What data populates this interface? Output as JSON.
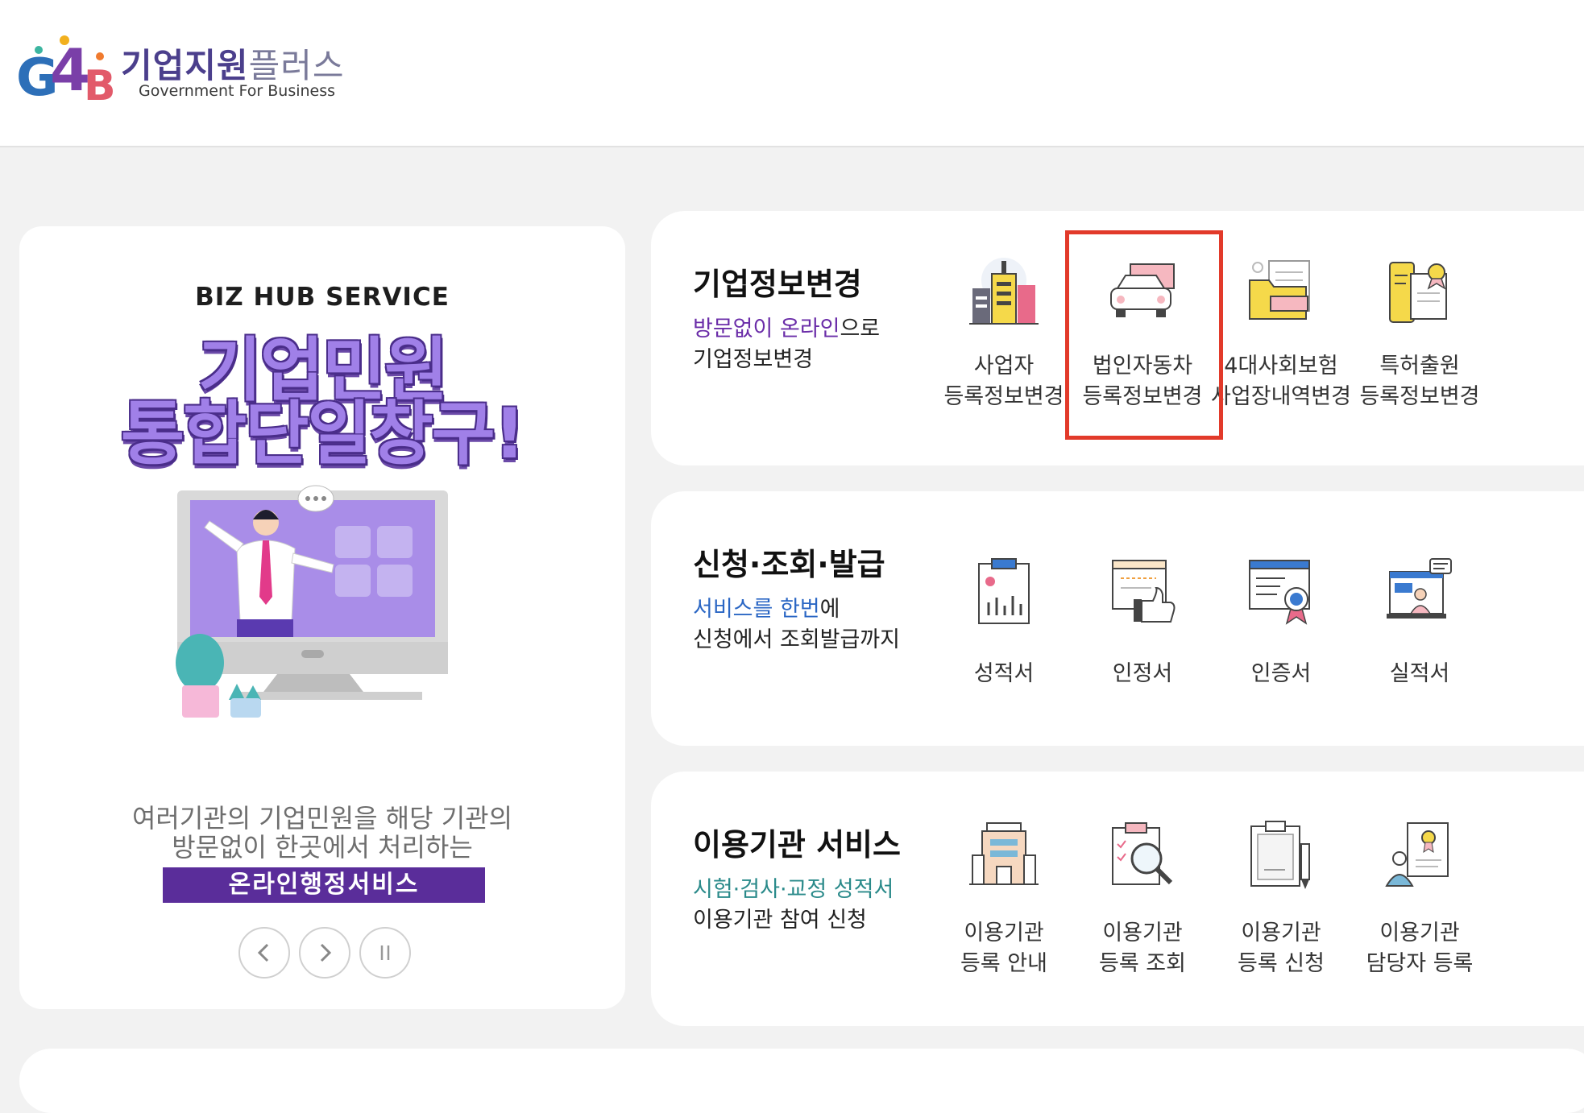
{
  "header": {
    "logo_mark_text": "G4B",
    "logo_title_bold": "기업지원",
    "logo_title_light": "플러스",
    "logo_subtitle": "Government For Business"
  },
  "banner": {
    "kicker": "BIZ HUB SERVICE",
    "title_line1": "기업민원",
    "title_line2": "통합단일창구!",
    "desc_line1": "여러기관의 기업민원을 해당 기관의",
    "desc_line2": "방문없이 한곳에서 처리하는",
    "badge": "온라인행정서비스",
    "controls": {
      "prev": "chevron-left",
      "next": "chevron-right",
      "pause": "pause"
    }
  },
  "sections": [
    {
      "title": "기업정보변경",
      "desc_highlight": "방문없이 온라인",
      "desc_rest": "으로",
      "desc_line2": "기업정보변경",
      "items": [
        {
          "line1": "사업자",
          "line2": "등록정보변경",
          "icon": "building-icon"
        },
        {
          "line1": "법인자동차",
          "line2": "등록정보변경",
          "icon": "car-icon"
        },
        {
          "line1": "4대사회보험",
          "line2": "사업장내역변경",
          "icon": "folder-icon"
        },
        {
          "line1": "특허출원",
          "line2": "등록정보변경",
          "icon": "patent-document-icon"
        }
      ]
    },
    {
      "title": "신청·조회·발급",
      "desc_highlight": "서비스를 한번",
      "desc_rest": "에",
      "desc_line2": "신청에서 조회발급까지",
      "items": [
        {
          "line1": "성적서",
          "line2": "",
          "icon": "report-chart-icon"
        },
        {
          "line1": "인정서",
          "line2": "",
          "icon": "thumbs-up-certificate-icon"
        },
        {
          "line1": "인증서",
          "line2": "",
          "icon": "certified-badge-icon"
        },
        {
          "line1": "실적서",
          "line2": "",
          "icon": "presentation-icon"
        }
      ]
    },
    {
      "title": "이용기관 서비스",
      "desc_highlight": "시험·검사·교정 성적서",
      "desc_rest": "",
      "desc_line2": "이용기관 참여 신청",
      "items": [
        {
          "line1": "이용기관",
          "line2": "등록 안내",
          "icon": "office-building-icon"
        },
        {
          "line1": "이용기관",
          "line2": "등록 조회",
          "icon": "magnifier-clipboard-icon"
        },
        {
          "line1": "이용기관",
          "line2": "등록 신청",
          "icon": "clipboard-pencil-icon"
        },
        {
          "line1": "이용기관",
          "line2": "담당자 등록",
          "icon": "person-certificate-icon"
        }
      ]
    }
  ],
  "colors": {
    "highlight_border": "#e23a2a",
    "brand_purple": "#5a2d9a",
    "desc_purple": "#6a2ca8",
    "desc_blue": "#2a66c4",
    "desc_teal": "#2a8a8a"
  }
}
